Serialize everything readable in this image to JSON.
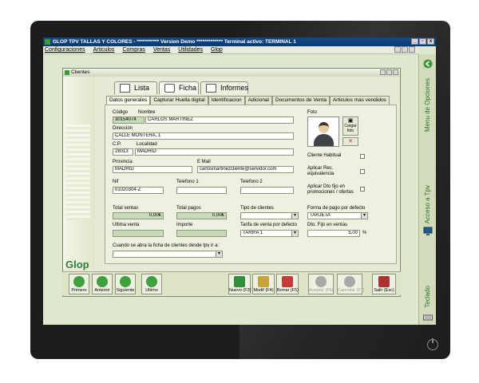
{
  "app": {
    "title": "GLOP TPV TALLAS Y COLORES - *********** Version Demo ************* Terminal activo: TERMINAL 1",
    "menu": [
      "Configuraciones",
      "Articulos",
      "Compras",
      "Ventas",
      "Utilidades",
      "Glop"
    ]
  },
  "sidebar": {
    "options_label": "Menu de Opciones",
    "access_label": "Acceso a Tpv",
    "keyboard_label": "Teclado"
  },
  "window": {
    "title": "Clientes",
    "main_tabs": [
      "Lista",
      "Ficha",
      "Informes"
    ],
    "sub_tabs": [
      "Datos generales",
      "Capturar Huella digital",
      "Identificacion",
      "Adicional",
      "Documentos de Venta",
      "Articulos mas vendidos"
    ],
    "brand": "Glop"
  },
  "form": {
    "codigo_label": "Código",
    "codigo": "30154074",
    "nombre_label": "Nombre",
    "nombre": "CARLOS MARTÍNEZ",
    "direccion_label": "Dirección",
    "direccion": "CALLE MONTERA, 1",
    "cp_label": "C.P.",
    "cp": "28013",
    "localidad_label": "Localidad",
    "localidad": "MADRID",
    "provincia_label": "Provincia",
    "provincia": "MADRID",
    "email_label": "E Mail",
    "email": "carlosmartinezcliente@servidor.com",
    "nif_label": "Nif",
    "nif": "01020304-Z",
    "telefono1_label": "Telefono 1",
    "telefono1": "",
    "telefono2_label": "Telefono 2",
    "telefono2": "",
    "total_ventas_label": "Total ventas",
    "total_ventas": "0,00€",
    "total_pagos_label": "Total pagos",
    "total_pagos": "0,00€",
    "tipo_clientes_label": "Tipo de clientes",
    "tipo_clientes": "",
    "forma_pago_label": "Forma de pago por defecto",
    "forma_pago": "TARJETA",
    "ultima_venta_label": "Ultima venta",
    "ultima_venta": "",
    "importe_label": "Importe",
    "importe": "",
    "tarifa_label": "Tarifa de venta por defecto",
    "tarifa": "TARIFA 1",
    "dto_label": "Dto. Fijo en ventas",
    "dto": "5,00",
    "dto_unit": "%",
    "ficha_label": "Cuando se abra la ficha de clientes desde tpv ir a:",
    "ficha": "",
    "foto_label": "Foto",
    "cargar_foto": "Cargar foto",
    "cliente_habitual_label": "Cliente Habitual",
    "aplicar_rec_label_1": "Aplicar Rec.",
    "aplicar_rec_label_2": "equivalencia",
    "aplicar_dto_label_1": "Aplicar Dto fijo en",
    "aplicar_dto_label_2": "promociones / ofertas"
  },
  "toolbar": {
    "primero": "Primero",
    "anterior": "Anterior",
    "siguiente": "Siguiente",
    "ultimo": "Ultimo",
    "nuevo": "Nuevo (F3)",
    "modif": "Modif (F4)",
    "borrar": "Borrar (F5)",
    "aceptar": "Aceptar (F6)",
    "cancelar": "Cancelar (F7)",
    "salir": "Salir (Esc)"
  }
}
